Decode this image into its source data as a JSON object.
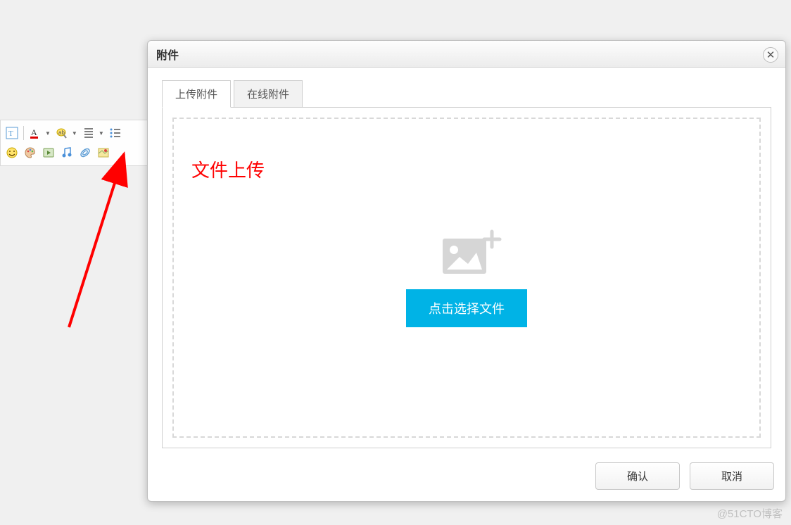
{
  "toolbar": {
    "icons": [
      "autotype",
      "font-color",
      "highlight",
      "line-spacing",
      "bullet-list",
      "emoji",
      "paint",
      "video",
      "music",
      "attachment",
      "map"
    ]
  },
  "annotation": {
    "label": "文件上传"
  },
  "dialog": {
    "title": "附件",
    "tabs": [
      {
        "label": "上传附件",
        "active": true
      },
      {
        "label": "在线附件",
        "active": false
      }
    ],
    "select_button": "点击选择文件",
    "confirm": "确认",
    "cancel": "取消"
  },
  "watermark": "@51CTO博客",
  "colors": {
    "accent": "#00b3e6",
    "annotation": "#ff0000"
  }
}
